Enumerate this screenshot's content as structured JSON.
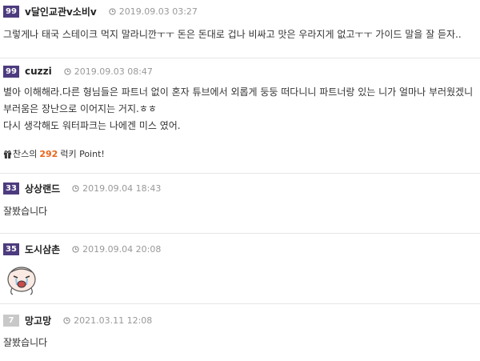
{
  "colors": {
    "level_badge": "#4d3b7f",
    "level_badge_low": "#c8c8c8",
    "lucky_number": "#e8651a"
  },
  "comments": [
    {
      "level": "99",
      "nickname": "v달인교관v소비v",
      "time": "2019.09.03 03:27",
      "lines": [
        "그렇게나 태국 스테이크 먹지 말라니깐ㅜㅜ 돈은 돈대로 겁나 비싸고 맛은 우라지게 없고ㅜㅜ 가이드 말을 잘 듣자.."
      ]
    },
    {
      "level": "99",
      "nickname": "cuzzi",
      "time": "2019.09.03 08:47",
      "lines": [
        "별아 이해해라.다른 형님들은 파트너 없이 혼자 튜브에서 외롭게 둥둥 떠다니니 파트너랑 있는 니가 얼마나 부러웠겠니",
        "부러움은 장난으로 이어지는 거지.ㅎㅎ",
        "다시 생각해도 워터파크는 나에겐 미스 였어."
      ],
      "lucky": {
        "prefix": "찬스의",
        "number": "292",
        "suffix": "럭키 Point!"
      }
    },
    {
      "level": "33",
      "nickname": "상상랜드",
      "time": "2019.09.04 18:43",
      "lines": [
        "잘봤습니다"
      ]
    },
    {
      "level": "35",
      "nickname": "도시삼촌",
      "time": "2019.09.04 20:08",
      "lines": [],
      "emoticon": "crying-emoticon"
    },
    {
      "level": "7",
      "nickname": "망고망",
      "time": "2021.03.11 12:08",
      "lines": [
        "잘봤습니다"
      ]
    }
  ]
}
